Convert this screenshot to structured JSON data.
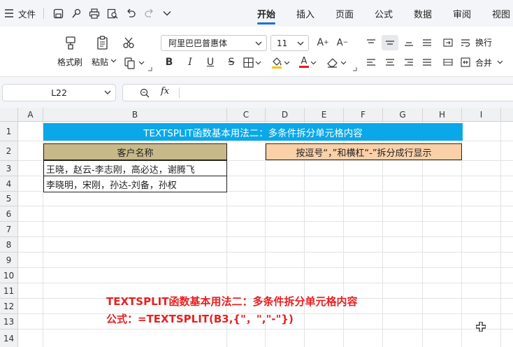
{
  "menubar": {
    "file_label": "文件",
    "tabs": [
      {
        "label": "开始",
        "active": true
      },
      {
        "label": "插入",
        "active": false
      },
      {
        "label": "页面",
        "active": false
      },
      {
        "label": "公式",
        "active": false
      },
      {
        "label": "数据",
        "active": false
      },
      {
        "label": "审阅",
        "active": false
      },
      {
        "label": "视图",
        "active": false
      }
    ]
  },
  "ribbon": {
    "format_painter": "格式刷",
    "paste": "粘贴",
    "font_name": "阿里巴巴普惠体",
    "font_size": "11",
    "wrap": "换行",
    "merge": "合并"
  },
  "formula_bar": {
    "cell_ref": "L22",
    "fx": "fx",
    "formula": ""
  },
  "columns": [
    "A",
    "B",
    "C",
    "D",
    "E",
    "F",
    "G",
    "H",
    "I"
  ],
  "rows": [
    "1",
    "2",
    "3",
    "4",
    "5",
    "6",
    "7",
    "8",
    "9",
    "10",
    "11",
    "12",
    "13",
    "14"
  ],
  "cells": {
    "title": "TEXTSPLIT函数基本用法二：多条件拆分单元格内容",
    "header": "客户名称",
    "row3": "王晓，赵云-李志刚，高必达，谢腾飞",
    "row4": "李晓明，宋刚，孙达-刘备，孙权",
    "note": "按逗号“，”和横杠“-”拆分成行显示"
  },
  "overlay": {
    "line1": "TEXTSPLIT函数基本用法二：多条件拆分单元格内容",
    "line2": "公式：=TEXTSPLIT(B3,{\"，\",\"-\"})"
  },
  "colors": {
    "accent": "#1e6fd9",
    "title_bg": "#0aa8e8",
    "header_bg": "#c8b98a",
    "note_bg": "#fad0a8",
    "overlay_text": "#e82020"
  }
}
